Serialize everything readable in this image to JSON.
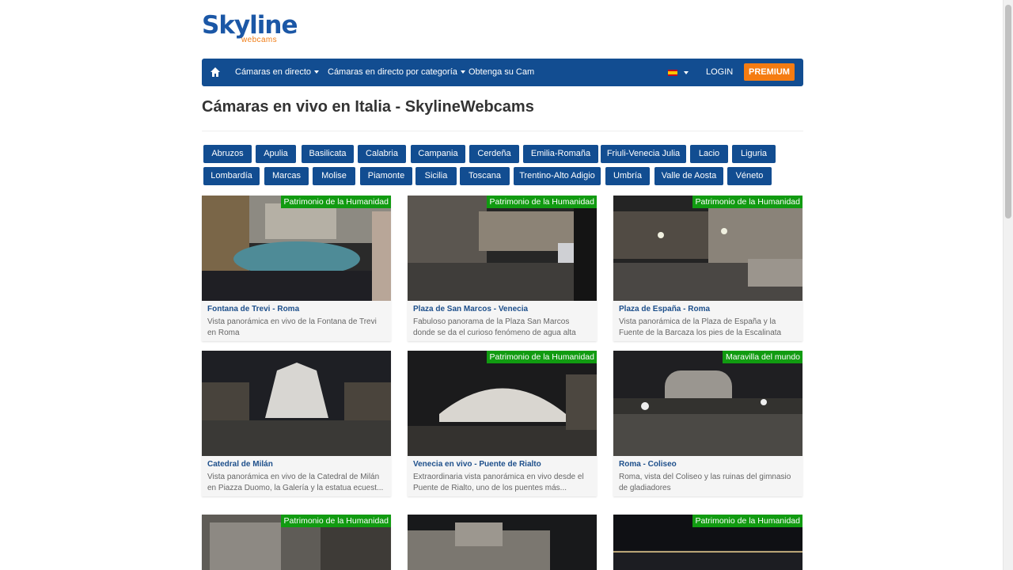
{
  "logo": {
    "main": "Skyline",
    "sub": "webcams"
  },
  "nav": {
    "items": [
      {
        "label": "Cámaras en directo",
        "dropdown": true
      },
      {
        "label": "Cámaras en directo por categoría",
        "dropdown": true
      },
      {
        "label": "Obtenga su Cam",
        "dropdown": false
      }
    ],
    "language_flag": "spain-flag-icon",
    "login": "LOGIN",
    "premium": "PREMIUM"
  },
  "page_title": "Cámaras en vivo en Italia - SkylineWebcams",
  "regions": {
    "row1": [
      "Abruzos",
      "Apulia",
      "Basilicata",
      "Calabria",
      "Campania",
      "Cerdeña",
      "Emilia-Romaña",
      "Friuli-Venecia Julia",
      "Lacio",
      "Liguria"
    ],
    "row2": [
      "Lombardía",
      "Marcas",
      "Molise",
      "Piamonte",
      "Sicilia",
      "Toscana",
      "Trentino-Alto Adigio",
      "Umbría",
      "Valle de Aosta",
      "Véneto"
    ]
  },
  "webcams": [
    {
      "badge": "Patrimonio de la Humanidad",
      "title": "Fontana de Trevi - Roma",
      "desc": "Vista panorámica en vivo de la Fontana de Trevi en Roma"
    },
    {
      "badge": "Patrimonio de la Humanidad",
      "title": "Plaza de San Marcos - Venecia",
      "desc": "Fabuloso panorama de la Plaza San Marcos donde se da el curioso fenómeno de agua alta"
    },
    {
      "badge": "Patrimonio de la Humanidad",
      "title": "Plaza de España - Roma",
      "desc": "Vista panorámica de la Plaza de España y la Fuente de la Barcaza los pies de la Escalinata"
    },
    {
      "badge": "",
      "title": "Catedral de Milán",
      "desc": "Vista panorámica en vivo de la Catedral de Milán en Piazza Duomo, la Galería y la estatua ecuest..."
    },
    {
      "badge": "Patrimonio de la Humanidad",
      "title": "Venecia en vivo - Puente de Rialto",
      "desc": "Extraordinaria vista panorámica en vivo desde el Puente de Rialto, uno de los puentes más..."
    },
    {
      "badge": "Maravilla del mundo",
      "title": "Roma - Coliseo",
      "desc": "Roma, vista del Coliseo y las ruinas del gimnasio de gladiadores"
    },
    {
      "badge": "Patrimonio de la Humanidad",
      "title": "",
      "desc": ""
    },
    {
      "badge": "",
      "title": "",
      "desc": ""
    },
    {
      "badge": "Patrimonio de la Humanidad",
      "title": "",
      "desc": ""
    }
  ],
  "colors": {
    "nav": "#124d91",
    "premium": "#f57c12",
    "badge": "#119b11",
    "title_link": "#1d4f8b"
  }
}
